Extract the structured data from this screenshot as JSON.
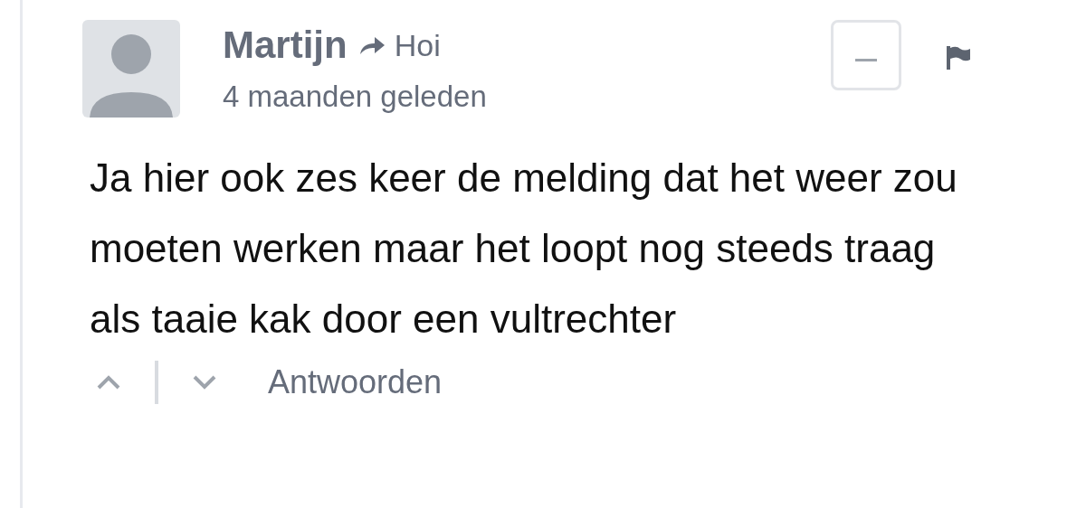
{
  "comment": {
    "author": "Martijn",
    "reply_to": "Hoi",
    "timestamp": "4 maanden geleden",
    "body": "Ja hier ook zes keer de melding dat het weer zou moeten werken maar het loopt nog steeds traag als taaie kak door een vultrechter",
    "collapsed": false
  },
  "actions": {
    "reply": "Antwoorden"
  }
}
